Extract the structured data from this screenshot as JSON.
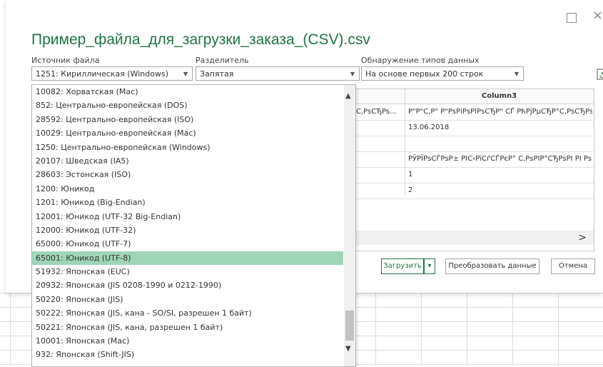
{
  "dialog": {
    "title": "Пример_файла_для_загрузки_заказа_(CSV).csv",
    "window_controls": {
      "maximize": "□",
      "close": "×"
    }
  },
  "file_origin": {
    "label": "Источник файла",
    "selected": "1251: Кириллическая (Windows)"
  },
  "delimiter": {
    "label": "Разделитель",
    "selected": "Запятая"
  },
  "type_detection": {
    "label": "Обнаружение типов данных",
    "selected": "На основе первых 200 строк"
  },
  "preview": {
    "column_header": "Column3",
    "rows": [
      {
        "left": "C,PsCЂPs...",
        "value": "Р\"Р\"С,Р\" Р\"РѕРіРѕРІРѕСЂР\" СЃ РћРјРµСЂР°С,РѕСЂРѕРј"
      },
      {
        "left": "",
        "value": "13.06.2018"
      },
      {
        "left": "",
        "value": ""
      },
      {
        "left": "",
        "value": "РЎРЇРѕСЃРѕР± РІС‹РїСѓСЃРєР° С‚РѕРІР°СЂРѕРІ РІ РѕР±"
      },
      {
        "left": "",
        "value": "1"
      },
      {
        "left": "",
        "value": "2"
      }
    ]
  },
  "buttons": {
    "load": "Загрузить",
    "load_arrow": "▾",
    "transform": "Преобразовать данные",
    "cancel": "Отмена"
  },
  "dropdown_options": [
    "10082: Хорватская (Mac)",
    "852: Центрально-европейская (DOS)",
    "28592: Центрально-европейская (ISO)",
    "10029: Центрально-европейская (Mac)",
    "1250: Центрально-европейская (Windows)",
    "20107: Шведская (IA5)",
    "28603: Эстонская (ISO)",
    "1200: Юникод",
    "1201: Юникод (Big-Endian)",
    "12001: Юникод (UTF-32 Big-Endian)",
    "12000: Юникод (UTF-32)",
    "65000: Юникод (UTF-7)",
    "65001: Юникод (UTF-8)",
    "51932: Японская (EUC)",
    "20932: Японская (JIS 0208-1990 и 0212-1990)",
    "50220: Японская (JIS)",
    "50222: Японская (JIS, кана - SO/SI, разрешен 1 байт)",
    "50221: Японская (JIS, кана, разрешен 1 байт)",
    "10001: Японская (Mac)",
    "932: Японская (Shift-JIS)"
  ],
  "dropdown_selected": "65001: Юникод (UTF-8)",
  "colors": {
    "accent": "#217346",
    "selected_option": "#9fd5b7"
  },
  "icons": {
    "chevron": "chevron-down-icon",
    "refresh": "refresh-icon",
    "scroll_up": "scroll-up-icon",
    "scroll_down": "scroll-down-icon",
    "scroll_right": "scroll-right-icon"
  }
}
